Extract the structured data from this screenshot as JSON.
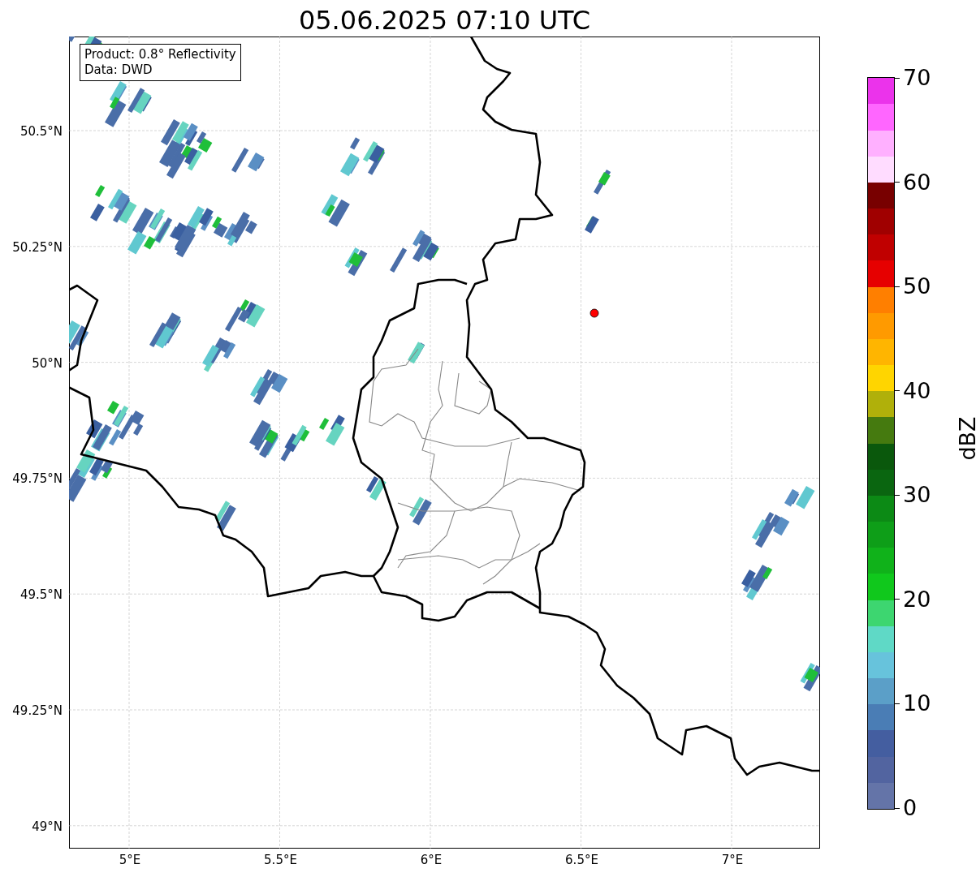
{
  "title": "05.06.2025 07:10 UTC",
  "legend": [
    "Product: 0.8° Reflectivity",
    "Data: DWD"
  ],
  "x_ticks": [
    "5°E",
    "5.5°E",
    "6°E",
    "6.5°E",
    "7°E"
  ],
  "y_ticks": [
    "50.5°N",
    "50.25°N",
    "50°N",
    "49.75°N",
    "49.5°N",
    "49.25°N",
    "49°N"
  ],
  "colorbar": {
    "label": "dBZ",
    "ticks": [
      "70",
      "60",
      "50",
      "40",
      "30",
      "20",
      "10",
      "0"
    ],
    "bands": [
      {
        "color": "#6474a8"
      },
      {
        "color": "#5264a0"
      },
      {
        "color": "#445ea0"
      },
      {
        "color": "#4a7db5"
      },
      {
        "color": "#5b9fc8"
      },
      {
        "color": "#67c3dc"
      },
      {
        "color": "#5fd9c6"
      },
      {
        "color": "#3dd670"
      },
      {
        "color": "#10c81c"
      },
      {
        "color": "#10b21a"
      },
      {
        "color": "#0e9e18"
      },
      {
        "color": "#0c8a15"
      },
      {
        "color": "#0a6610"
      },
      {
        "color": "#0a580c"
      },
      {
        "color": "#457a0f"
      },
      {
        "color": "#b0b00a"
      },
      {
        "color": "#ffd500"
      },
      {
        "color": "#ffb500"
      },
      {
        "color": "#ff9a00"
      },
      {
        "color": "#ff7f00"
      },
      {
        "color": "#e60000"
      },
      {
        "color": "#c00000"
      },
      {
        "color": "#a00000"
      },
      {
        "color": "#780000"
      },
      {
        "color": "#ffdcff"
      },
      {
        "color": "#ffb0ff"
      },
      {
        "color": "#ff66ff"
      },
      {
        "color": "#eb33eb"
      }
    ]
  }
}
